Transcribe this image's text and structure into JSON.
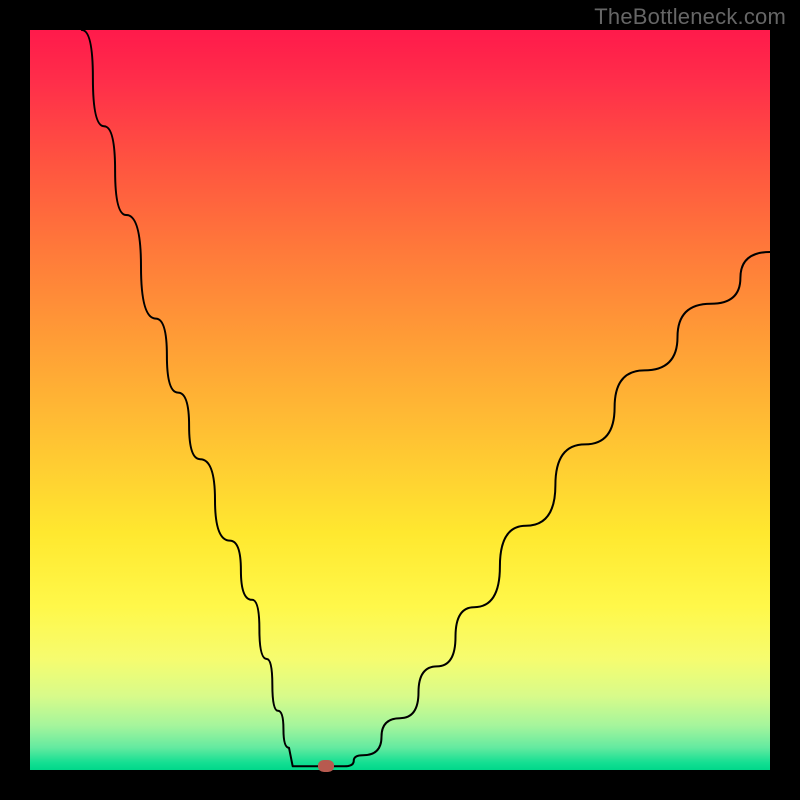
{
  "watermark": "TheBottleneck.com",
  "colors": {
    "frame": "#000000",
    "curve": "#000000",
    "marker": "#b75a4f",
    "gradient_stops": [
      "#ff1a4b",
      "#ff2e4a",
      "#ff5440",
      "#ff7a3a",
      "#ff9d36",
      "#ffc233",
      "#ffe82f",
      "#fff84a",
      "#f6fc6f",
      "#d8fb8a",
      "#a5f59c",
      "#63eaa0",
      "#14df92",
      "#00d88a"
    ]
  },
  "chart_data": {
    "type": "line",
    "title": "",
    "xlabel": "",
    "ylabel": "",
    "xlim": [
      0,
      100
    ],
    "ylim": [
      0,
      100
    ],
    "grid": false,
    "legend": false,
    "series": [
      {
        "name": "curve",
        "x": [
          7,
          10,
          13,
          17,
          20,
          23,
          27,
          30,
          32,
          33.5,
          35,
          36,
          37.2,
          42,
          45,
          50,
          55,
          60,
          67,
          75,
          83,
          92,
          100
        ],
        "y": [
          100,
          87,
          75,
          61,
          51,
          42,
          31,
          23,
          15,
          8,
          3,
          1,
          0.5,
          0.5,
          2,
          7,
          14,
          22,
          33,
          44,
          54,
          63,
          70
        ]
      }
    ],
    "flat_segment": {
      "x_start": 35.5,
      "x_end": 42.5,
      "y": 0.5
    },
    "marker": {
      "x": 40,
      "y": 0.5
    },
    "notes": "y is read as percent of plot height from bottom; x as percent of plot width from left. Values estimated from pixels."
  }
}
